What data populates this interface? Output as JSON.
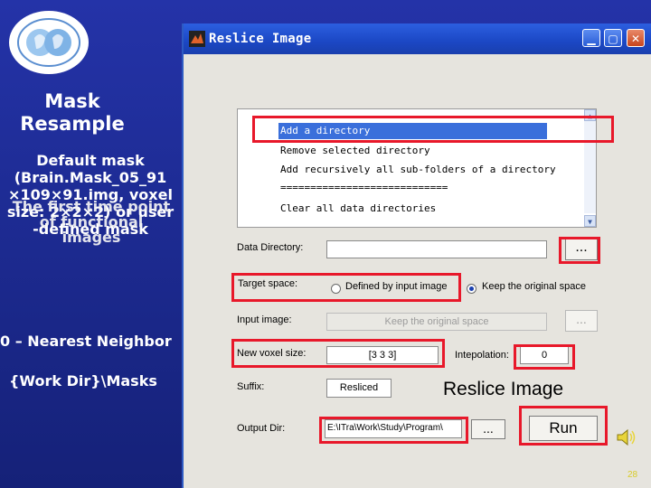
{
  "slide": {
    "title": "Mask\nResample",
    "default_mask": "Default mask\n(Brain.Mask_05_91\n×109×91.img, voxel\nsize: 2×2×2) or user\n-defined mask",
    "first_time": "The first time point\nof functional\nimages",
    "nearest_neighbor": "0 – Nearest Neighbor",
    "work_dir": "{Work Dir}\\Masks",
    "page_number": "28"
  },
  "window": {
    "title": "Reslice Image",
    "minimize": "▁",
    "maximize": "▢",
    "close": "✕"
  },
  "list": {
    "items": [
      "Add a directory",
      "Remove selected directory",
      "Add recursively all sub-folders of a directory",
      "============================",
      "Clear all data directories"
    ],
    "selected_index": 0
  },
  "form": {
    "data_directory_label": "Data Directory:",
    "data_directory_value": "",
    "browse_dots": "...",
    "target_space_label": "Target space:",
    "option_input_image": "Defined by input image",
    "option_keep_original": "Keep the original space",
    "selected_option": "Keep the original space",
    "input_image_label": "Input image:",
    "input_image_value": "Keep the original space",
    "new_voxel_size_label": "New voxel size:",
    "new_voxel_size_value": "[3 3 3]",
    "interpolation_label": "Intepolation:",
    "interpolation_value": "0",
    "suffix_label": "Suffix:",
    "suffix_value": "Resliced",
    "output_dir_label": "Output Dir:",
    "output_dir_value": "E:\\ITra\\Work\\Study\\Program\\",
    "run_label": "Run",
    "reslice_caption": "Reslice Image"
  },
  "colors": {
    "slide_background": "#1c2a8f",
    "highlight_box": "#e8182a",
    "titlebar": "#1b47c4",
    "selection": "#3a6fdb"
  }
}
